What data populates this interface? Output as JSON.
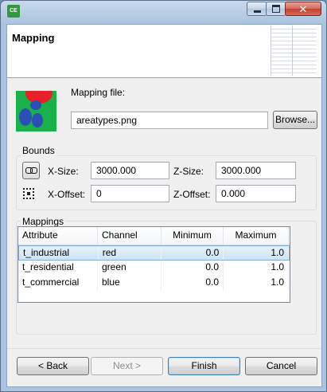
{
  "window": {
    "app_icon_text": "CE"
  },
  "header": {
    "title": "Mapping"
  },
  "mapping_file": {
    "label": "Mapping file:",
    "value": "areatypes.png",
    "browse_label": "Browse..."
  },
  "bounds": {
    "title": "Bounds",
    "x_size_label": "X-Size:",
    "x_size_value": "3000.000",
    "z_size_label": "Z-Size:",
    "z_size_value": "3000.000",
    "x_offset_label": "X-Offset:",
    "x_offset_value": "0",
    "z_offset_label": "Z-Offset:",
    "z_offset_value": "0.000"
  },
  "mappings": {
    "title": "Mappings",
    "columns": [
      "Attribute",
      "Channel",
      "Minimum",
      "Maximum"
    ],
    "rows": [
      {
        "attribute": "t_industrial",
        "channel": "red",
        "minimum": "0.0",
        "maximum": "1.0"
      },
      {
        "attribute": "t_residential",
        "channel": "green",
        "minimum": "0.0",
        "maximum": "1.0"
      },
      {
        "attribute": "t_commercial",
        "channel": "blue",
        "minimum": "0.0",
        "maximum": "1.0"
      }
    ],
    "selected_row": 0
  },
  "footer": {
    "back_label": "< Back",
    "next_label": "Next >",
    "finish_label": "Finish",
    "cancel_label": "Cancel"
  },
  "colors": {
    "map_green": "#1bb14a",
    "map_red": "#e8202a",
    "map_blue": "#2b4fb5"
  }
}
